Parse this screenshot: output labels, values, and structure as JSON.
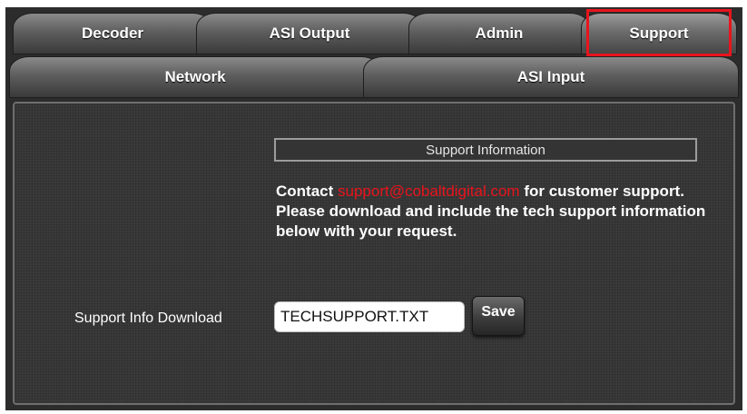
{
  "tabs_row1": [
    {
      "label": "Decoder"
    },
    {
      "label": "ASI Output"
    },
    {
      "label": "Admin"
    },
    {
      "label": "Support",
      "active": true
    }
  ],
  "tabs_row2": [
    {
      "label": "Network"
    },
    {
      "label": "ASI Input"
    }
  ],
  "support": {
    "header": "Support Information",
    "contact_prefix": "Contact ",
    "email": "support@cobaltdigital.com",
    "contact_suffix": " for customer support. Please download and include the tech support information below with your request.",
    "download_label": "Support Info Download",
    "filename_value": "TECHSUPPORT.TXT",
    "save_label": "Save"
  },
  "colors": {
    "highlight": "#e8141c",
    "email": "#e8141c",
    "panel": "#3a3a3a"
  }
}
